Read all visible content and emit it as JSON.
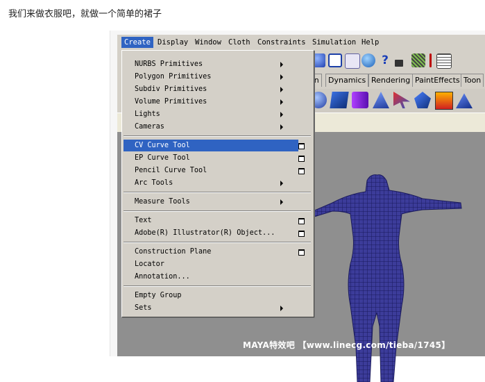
{
  "caption": "我们来做衣服吧，就做一个简单的裙子",
  "menubar": [
    "Create",
    "Display",
    "Window",
    "Cloth",
    "Constraints",
    "Simulation",
    "Help"
  ],
  "tabs": [
    "ion",
    "Dynamics",
    "Rendering",
    "PaintEffects",
    "Toon"
  ],
  "create_menu": {
    "items": [
      {
        "label": "NURBS Primitives",
        "submenu": true
      },
      {
        "label": "Polygon Primitives",
        "submenu": true
      },
      {
        "label": "Subdiv Primitives",
        "submenu": true
      },
      {
        "label": "Volume Primitives",
        "submenu": true
      },
      {
        "label": "Lights",
        "submenu": true
      },
      {
        "label": "Cameras",
        "submenu": true
      },
      {
        "label": "CV Curve Tool",
        "option": true,
        "selected": true
      },
      {
        "label": "EP Curve Tool",
        "option": true
      },
      {
        "label": "Pencil Curve Tool",
        "option": true
      },
      {
        "label": "Arc Tools",
        "submenu": true
      },
      {
        "label": "Measure Tools",
        "submenu": true
      },
      {
        "label": "Text",
        "option": true
      },
      {
        "label": "Adobe(R) Illustrator(R) Object...",
        "option": true
      },
      {
        "label": "Construction Plane",
        "option": true
      },
      {
        "label": "Locator"
      },
      {
        "label": "Annotation..."
      },
      {
        "label": "Empty Group"
      },
      {
        "label": "Sets",
        "submenu": true
      }
    ]
  },
  "icons": {
    "toolbar": [
      "sphere-icon",
      "grid-icon",
      "snap-icon",
      "globe-icon",
      "help-icon",
      "lock-icon",
      "render-icon",
      "pin-icon",
      "grid-render-icon"
    ],
    "shelf": [
      "sphere-icon",
      "cube-icon",
      "cylinder-icon",
      "plane-icon",
      "arrow-tool-icon",
      "cone-icon",
      "ramp-icon",
      "mountain-icon"
    ]
  },
  "watermark": "MAYA特效吧 【www.linecg.com/tieba/1745】",
  "colors": {
    "highlight": "#2f63c2",
    "viewport": "#8f8f8f",
    "wireframe": "#24246e"
  }
}
